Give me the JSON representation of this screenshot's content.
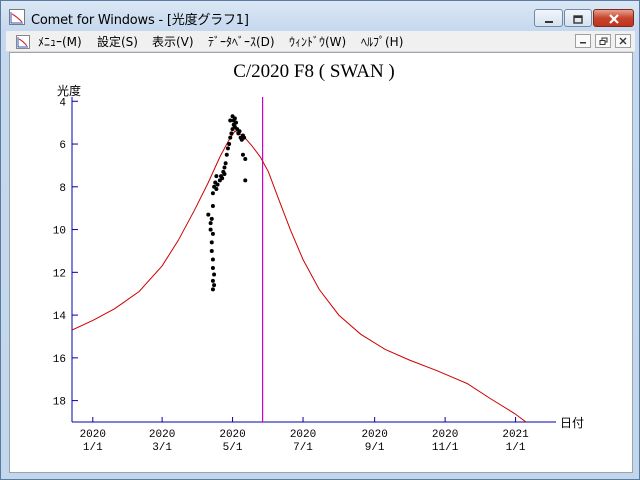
{
  "window": {
    "title": "Comet for Windows - [光度グラフ1]",
    "icon": "comet-app-icon"
  },
  "menubar": {
    "items": [
      "ﾒﾆｭｰ(M)",
      "設定(S)",
      "表示(V)",
      "ﾃﾞｰﾀﾍﾞｰｽ(D)",
      "ｳｨﾝﾄﾞｳ(W)",
      "ﾍﾙﾌﾟ(H)"
    ]
  },
  "chart_data": {
    "type": "scatter",
    "title": "C/2020 F8 ( SWAN )",
    "ylabel": "光度",
    "xlabel": "日付",
    "x_unit": "date",
    "xlim": [
      "2019-12-14",
      "2021-02-05"
    ],
    "ylim": [
      19,
      3.8
    ],
    "y_inverted": true,
    "y_ticks": [
      4,
      6,
      8,
      10,
      12,
      14,
      16,
      18
    ],
    "x_ticks": [
      {
        "year": "2020",
        "md": "1/1",
        "date": "2020-01-01"
      },
      {
        "year": "2020",
        "md": "3/1",
        "date": "2020-03-01"
      },
      {
        "year": "2020",
        "md": "5/1",
        "date": "2020-05-01"
      },
      {
        "year": "2020",
        "md": "7/1",
        "date": "2020-07-01"
      },
      {
        "year": "2020",
        "md": "9/1",
        "date": "2020-09-01"
      },
      {
        "year": "2020",
        "md": "11/1",
        "date": "2020-11-01"
      },
      {
        "year": "2021",
        "md": "1/1",
        "date": "2021-01-01"
      }
    ],
    "current_date_marker": "2020-05-27",
    "colors": {
      "axis": "#0000aa",
      "curve": "#cc0000",
      "marker": "#cc00cc",
      "points": "#000000"
    },
    "predicted_curve": [
      [
        "2019-12-14",
        14.7
      ],
      [
        "2020-01-01",
        14.25
      ],
      [
        "2020-01-20",
        13.7
      ],
      [
        "2020-02-10",
        12.9
      ],
      [
        "2020-03-01",
        11.7
      ],
      [
        "2020-03-15",
        10.5
      ],
      [
        "2020-03-29",
        9.1
      ],
      [
        "2020-04-10",
        7.8
      ],
      [
        "2020-04-20",
        6.6
      ],
      [
        "2020-04-28",
        5.8
      ],
      [
        "2020-05-03",
        5.4
      ],
      [
        "2020-05-10",
        5.6
      ],
      [
        "2020-05-18",
        6.1
      ],
      [
        "2020-05-25",
        6.6
      ],
      [
        "2020-06-01",
        7.3
      ],
      [
        "2020-06-10",
        8.6
      ],
      [
        "2020-06-20",
        10.0
      ],
      [
        "2020-07-01",
        11.4
      ],
      [
        "2020-07-15",
        12.8
      ],
      [
        "2020-08-01",
        14.0
      ],
      [
        "2020-08-20",
        14.9
      ],
      [
        "2020-09-10",
        15.6
      ],
      [
        "2020-10-01",
        16.1
      ],
      [
        "2020-10-25",
        16.6
      ],
      [
        "2020-11-20",
        17.2
      ],
      [
        "2020-12-10",
        17.9
      ],
      [
        "2020-12-31",
        18.6
      ],
      [
        "2021-01-10",
        19.0
      ]
    ],
    "observations": [
      [
        "2020-04-10",
        9.3
      ],
      [
        "2020-04-12",
        9.7
      ],
      [
        "2020-04-12",
        10.0
      ],
      [
        "2020-04-13",
        10.6
      ],
      [
        "2020-04-13",
        11.0
      ],
      [
        "2020-04-14",
        11.4
      ],
      [
        "2020-04-14",
        11.8
      ],
      [
        "2020-04-15",
        12.1
      ],
      [
        "2020-04-14",
        12.4
      ],
      [
        "2020-04-15",
        12.6
      ],
      [
        "2020-04-14",
        12.8
      ],
      [
        "2020-04-13",
        9.5
      ],
      [
        "2020-04-14",
        10.2
      ],
      [
        "2020-04-14",
        8.9
      ],
      [
        "2020-04-14",
        8.3
      ],
      [
        "2020-04-15",
        8.0
      ],
      [
        "2020-04-16",
        7.8
      ],
      [
        "2020-04-17",
        8.1
      ],
      [
        "2020-04-18",
        7.9
      ],
      [
        "2020-04-20",
        7.7
      ],
      [
        "2020-04-21",
        7.5
      ],
      [
        "2020-04-22",
        7.6
      ],
      [
        "2020-04-23",
        7.3
      ],
      [
        "2020-04-24",
        7.1
      ],
      [
        "2020-04-24",
        7.4
      ],
      [
        "2020-04-25",
        6.9
      ],
      [
        "2020-04-26",
        6.5
      ],
      [
        "2020-04-27",
        6.2
      ],
      [
        "2020-04-28",
        6.0
      ],
      [
        "2020-04-29",
        5.7
      ],
      [
        "2020-04-30",
        5.5
      ],
      [
        "2020-05-01",
        5.3
      ],
      [
        "2020-05-02",
        5.1
      ],
      [
        "2020-05-02",
        4.9
      ],
      [
        "2020-05-03",
        4.8
      ],
      [
        "2020-05-03",
        5.2
      ],
      [
        "2020-05-04",
        5.0
      ],
      [
        "2020-05-05",
        5.3
      ],
      [
        "2020-05-06",
        5.5
      ],
      [
        "2020-05-07",
        5.4
      ],
      [
        "2020-05-08",
        5.7
      ],
      [
        "2020-05-09",
        5.8
      ],
      [
        "2020-05-10",
        5.6
      ],
      [
        "2020-05-11",
        5.7
      ],
      [
        "2020-05-10",
        6.5
      ],
      [
        "2020-05-12",
        6.7
      ],
      [
        "2020-05-12",
        7.7
      ],
      [
        "2020-04-17",
        7.5
      ],
      [
        "2020-04-29",
        4.9
      ],
      [
        "2020-05-01",
        4.7
      ]
    ]
  }
}
